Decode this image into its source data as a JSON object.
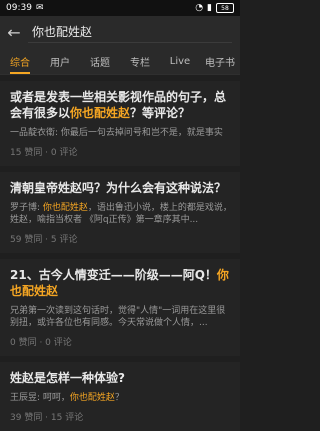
{
  "status": {
    "time": "09:39",
    "battery": "58"
  },
  "search": {
    "query": "你也配姓赵"
  },
  "tabs": [
    "综合",
    "用户",
    "话题",
    "专栏",
    "Live",
    "电子书"
  ],
  "results": [
    {
      "title_parts": [
        "或者是发表一些相关影视作品的句子，总会有很多以",
        "你也配姓赵",
        "？等评论？"
      ],
      "snippet": "一品靛衣衛: 你最后一句去掉问号和岂不是，就是事实",
      "meta": "15 赞同 · 0 评论"
    },
    {
      "title_parts": [
        "清朝皇帝姓赵吗？为什么会有这种说法？",
        "",
        ""
      ],
      "snippet_parts": [
        "罗子博: ",
        "你也配姓赵",
        "，语出鲁迅小说，楼上的都是戏说，姓赵，喻指当权者 《阿q正传》第一章序其中..."
      ],
      "meta": "59 赞同 · 5 评论"
    },
    {
      "title_parts": [
        "21、古今人情变迁——阶级——阿Q！",
        "你也配姓赵",
        ""
      ],
      "snippet": "兄弟第一次读到这句话时，觉得\"人情\"一词用在这里很别扭，或许各位也有同感。今天常说做个人情，...",
      "meta": "0 赞同 · 0 评论"
    },
    {
      "title_parts": [
        "姓赵是怎样一种体验?",
        "",
        ""
      ],
      "snippet_parts": [
        "王辰昱: 呵呵，",
        "你也配姓赵",
        "？"
      ],
      "meta": "39 赞同 · 15 评论"
    }
  ],
  "colors": {
    "accent": "#f5a623",
    "background": "#1f1f1f",
    "card": "#242424"
  }
}
